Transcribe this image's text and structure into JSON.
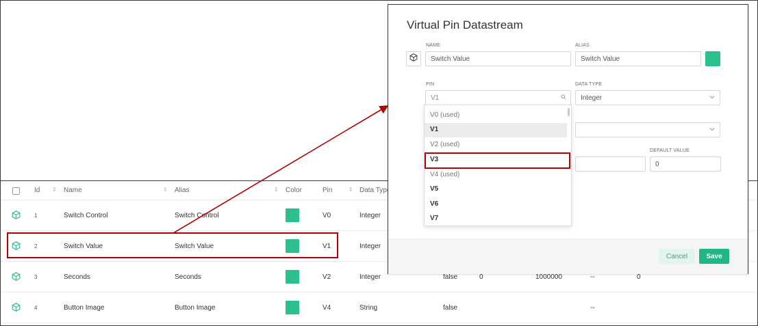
{
  "colors": {
    "accent": "#2bc08d",
    "save_button": "#1fb785",
    "cancel_button_bg": "#e3f4ee",
    "highlight": "#b00000"
  },
  "table": {
    "headers": {
      "id": "Id",
      "name": "Name",
      "alias": "Alias",
      "color": "Color",
      "pin": "Pin",
      "data_type": "Data Type"
    },
    "rows": [
      {
        "id": "1",
        "name": "Switch Control",
        "alias": "Switch Control",
        "pin": "V0",
        "data_type": "Integer",
        "extra": [
          "",
          "",
          "",
          "",
          ""
        ]
      },
      {
        "id": "2",
        "name": "Switch Value",
        "alias": "Switch Value",
        "pin": "V1",
        "data_type": "Integer",
        "extra": [
          "",
          "",
          "",
          "",
          ""
        ]
      },
      {
        "id": "3",
        "name": "Seconds",
        "alias": "Seconds",
        "pin": "V2",
        "data_type": "Integer",
        "extra": [
          "false",
          "0",
          "1000000",
          "--",
          "0"
        ]
      },
      {
        "id": "4",
        "name": "Button Image",
        "alias": "Button Image",
        "pin": "V4",
        "data_type": "String",
        "extra": [
          "false",
          "",
          "",
          "--",
          ""
        ]
      }
    ]
  },
  "dialog": {
    "title": "Virtual Pin Datastream",
    "name_label": "NAME",
    "name_value": "Switch Value",
    "alias_label": "ALIAS",
    "alias_value": "Switch Value",
    "pin_label": "PIN",
    "pin_value": "V1",
    "data_type_label": "DATA TYPE",
    "data_type_value": "Integer",
    "default_value_label": "DEFAULT VALUE",
    "default_value": "0",
    "cancel_label": "Cancel",
    "save_label": "Save"
  },
  "pin_dropdown": {
    "options": [
      "V0 (used)",
      "V1",
      "V2 (used)",
      "V3",
      "V4 (used)",
      "V5",
      "V6",
      "V7"
    ],
    "selected": "V1",
    "highlighted": "V3"
  },
  "icons": {
    "row_icon": "cube-icon",
    "chevron": "chevron-down-icon",
    "search": "search-icon",
    "sort": "sort-icon"
  }
}
